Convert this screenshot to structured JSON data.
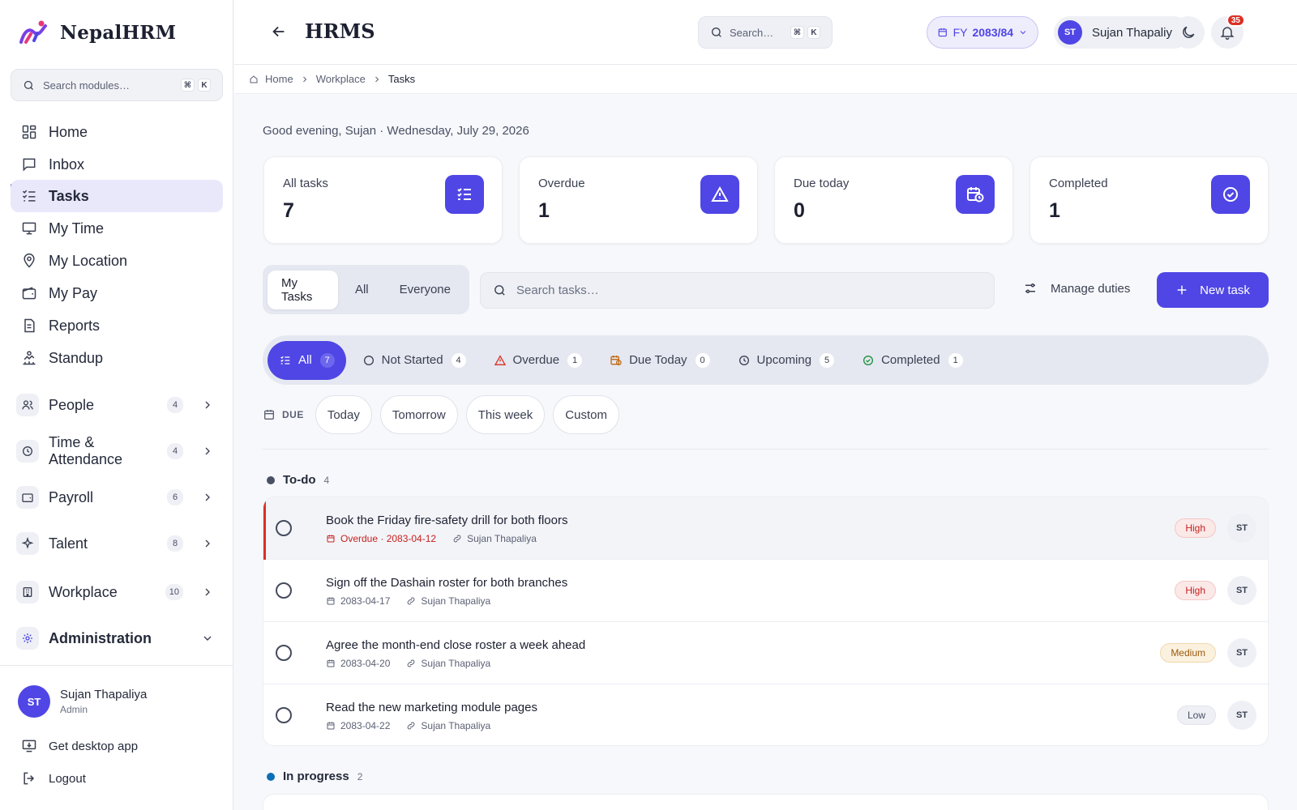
{
  "app": {
    "name": "NepalHRM"
  },
  "sidebar": {
    "search_placeholder": "Search modules…",
    "shortcut": [
      "⌘",
      "K"
    ],
    "nav": [
      {
        "label": "Home",
        "icon": "grid-icon"
      },
      {
        "label": "Inbox",
        "icon": "chat-icon"
      },
      {
        "label": "Tasks",
        "icon": "checklist-icon",
        "active": true
      },
      {
        "label": "My Time",
        "icon": "monitor-icon"
      },
      {
        "label": "My Location",
        "icon": "location-pin-icon"
      },
      {
        "label": "My Pay",
        "icon": "wallet-icon"
      },
      {
        "label": "Reports",
        "icon": "document-icon"
      },
      {
        "label": "Standup",
        "icon": "person-chart-icon"
      }
    ],
    "groups": [
      {
        "label": "People",
        "count": "4",
        "icon": "users-icon"
      },
      {
        "label": "Time & Attendance",
        "count": "4",
        "icon": "clock-icon"
      },
      {
        "label": "Payroll",
        "count": "6",
        "icon": "wallet-icon"
      },
      {
        "label": "Talent",
        "count": "8",
        "icon": "sparkle-icon"
      },
      {
        "label": "Workplace",
        "count": "10",
        "icon": "building-icon"
      },
      {
        "label": "Administration",
        "icon": "gear-icon",
        "expanded": true
      }
    ],
    "user": {
      "initials": "ST",
      "name": "Sujan Thapaliya",
      "role": "Admin"
    },
    "desktop_app": "Get desktop app",
    "logout": "Logout"
  },
  "topbar": {
    "title": "HRMS",
    "search_placeholder": "Search…",
    "shortcut": [
      "⌘",
      "K"
    ],
    "fy_prefix": "FY",
    "fy_value": "2083/84",
    "user_initials": "ST",
    "user_name": "Sujan Thapaliya",
    "notifications": "35"
  },
  "breadcrumb": [
    "Home",
    "Workplace",
    "Tasks"
  ],
  "greeting": "Good evening, Sujan · Wednesday, July 29, 2026",
  "stats": [
    {
      "label": "All tasks",
      "value": "7",
      "icon": "checklist-icon"
    },
    {
      "label": "Overdue",
      "value": "1",
      "icon": "warning-icon"
    },
    {
      "label": "Due today",
      "value": "0",
      "icon": "calendar-clock-icon"
    },
    {
      "label": "Completed",
      "value": "1",
      "icon": "check-circle-icon"
    }
  ],
  "scope_tabs": [
    {
      "label": "My Tasks",
      "active": true
    },
    {
      "label": "All"
    },
    {
      "label": "Everyone"
    }
  ],
  "task_search_placeholder": "Search tasks…",
  "manage_duties": "Manage duties",
  "new_task": "New task",
  "status_filters": [
    {
      "label": "All",
      "count": "7",
      "active": true
    },
    {
      "label": "Not Started",
      "count": "4"
    },
    {
      "label": "Overdue",
      "count": "1"
    },
    {
      "label": "Due Today",
      "count": "0"
    },
    {
      "label": "Upcoming",
      "count": "5"
    },
    {
      "label": "Completed",
      "count": "1"
    }
  ],
  "due_filter": {
    "label": "DUE",
    "options": [
      "Today",
      "Tomorrow",
      "This week",
      "Custom"
    ]
  },
  "colors": {
    "accent": "#4f46e5",
    "danger": "#d93025",
    "todo_dot": "#4a5064",
    "progress_dot": "#0b6fb8"
  },
  "sections": [
    {
      "title": "To-do",
      "count": "4",
      "tasks": [
        {
          "title": "Book the Friday fire-safety drill for both floors",
          "due": "Overdue · 2083-04-12",
          "overdue": true,
          "assignee": "Sujan Thapaliya",
          "priority": "High",
          "initials": "ST"
        },
        {
          "title": "Sign off the Dashain roster for both branches",
          "due": "2083-04-17",
          "assignee": "Sujan Thapaliya",
          "priority": "High",
          "initials": "ST"
        },
        {
          "title": "Agree the month-end close roster a week ahead",
          "due": "2083-04-20",
          "assignee": "Sujan Thapaliya",
          "priority": "Medium",
          "initials": "ST"
        },
        {
          "title": "Read the new marketing module pages",
          "due": "2083-04-22",
          "assignee": "Sujan Thapaliya",
          "priority": "Low",
          "initials": "ST"
        }
      ]
    },
    {
      "title": "In progress",
      "count": "2"
    }
  ]
}
